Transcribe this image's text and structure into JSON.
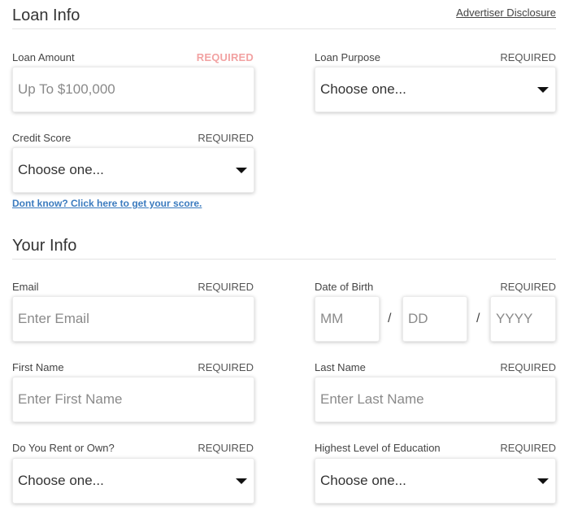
{
  "loan_info": {
    "title": "Loan Info",
    "disclosure": "Advertiser Disclosure",
    "loan_amount": {
      "label": "Loan Amount",
      "required": "REQUIRED",
      "placeholder": "Up To $100,000"
    },
    "loan_purpose": {
      "label": "Loan Purpose",
      "required": "REQUIRED",
      "value": "Choose one..."
    },
    "credit_score": {
      "label": "Credit Score",
      "required": "REQUIRED",
      "value": "Choose one..."
    },
    "help_link": "Dont know? Click here to get your score."
  },
  "your_info": {
    "title": "Your Info",
    "email": {
      "label": "Email",
      "required": "REQUIRED",
      "placeholder": "Enter Email"
    },
    "dob": {
      "label": "Date of Birth",
      "required": "REQUIRED",
      "month_placeholder": "MM",
      "day_placeholder": "DD",
      "year_placeholder": "YYYY",
      "separator": "/"
    },
    "first_name": {
      "label": "First Name",
      "required": "REQUIRED",
      "placeholder": "Enter First Name"
    },
    "last_name": {
      "label": "Last Name",
      "required": "REQUIRED",
      "placeholder": "Enter Last Name"
    },
    "rent_own": {
      "label": "Do You Rent or Own?",
      "required": "REQUIRED",
      "value": "Choose one..."
    },
    "education": {
      "label": "Highest Level of Education",
      "required": "REQUIRED",
      "value": "Choose one..."
    }
  },
  "colors": {
    "required_highlight": "#f2a2a2",
    "link": "#3b7bbf"
  }
}
